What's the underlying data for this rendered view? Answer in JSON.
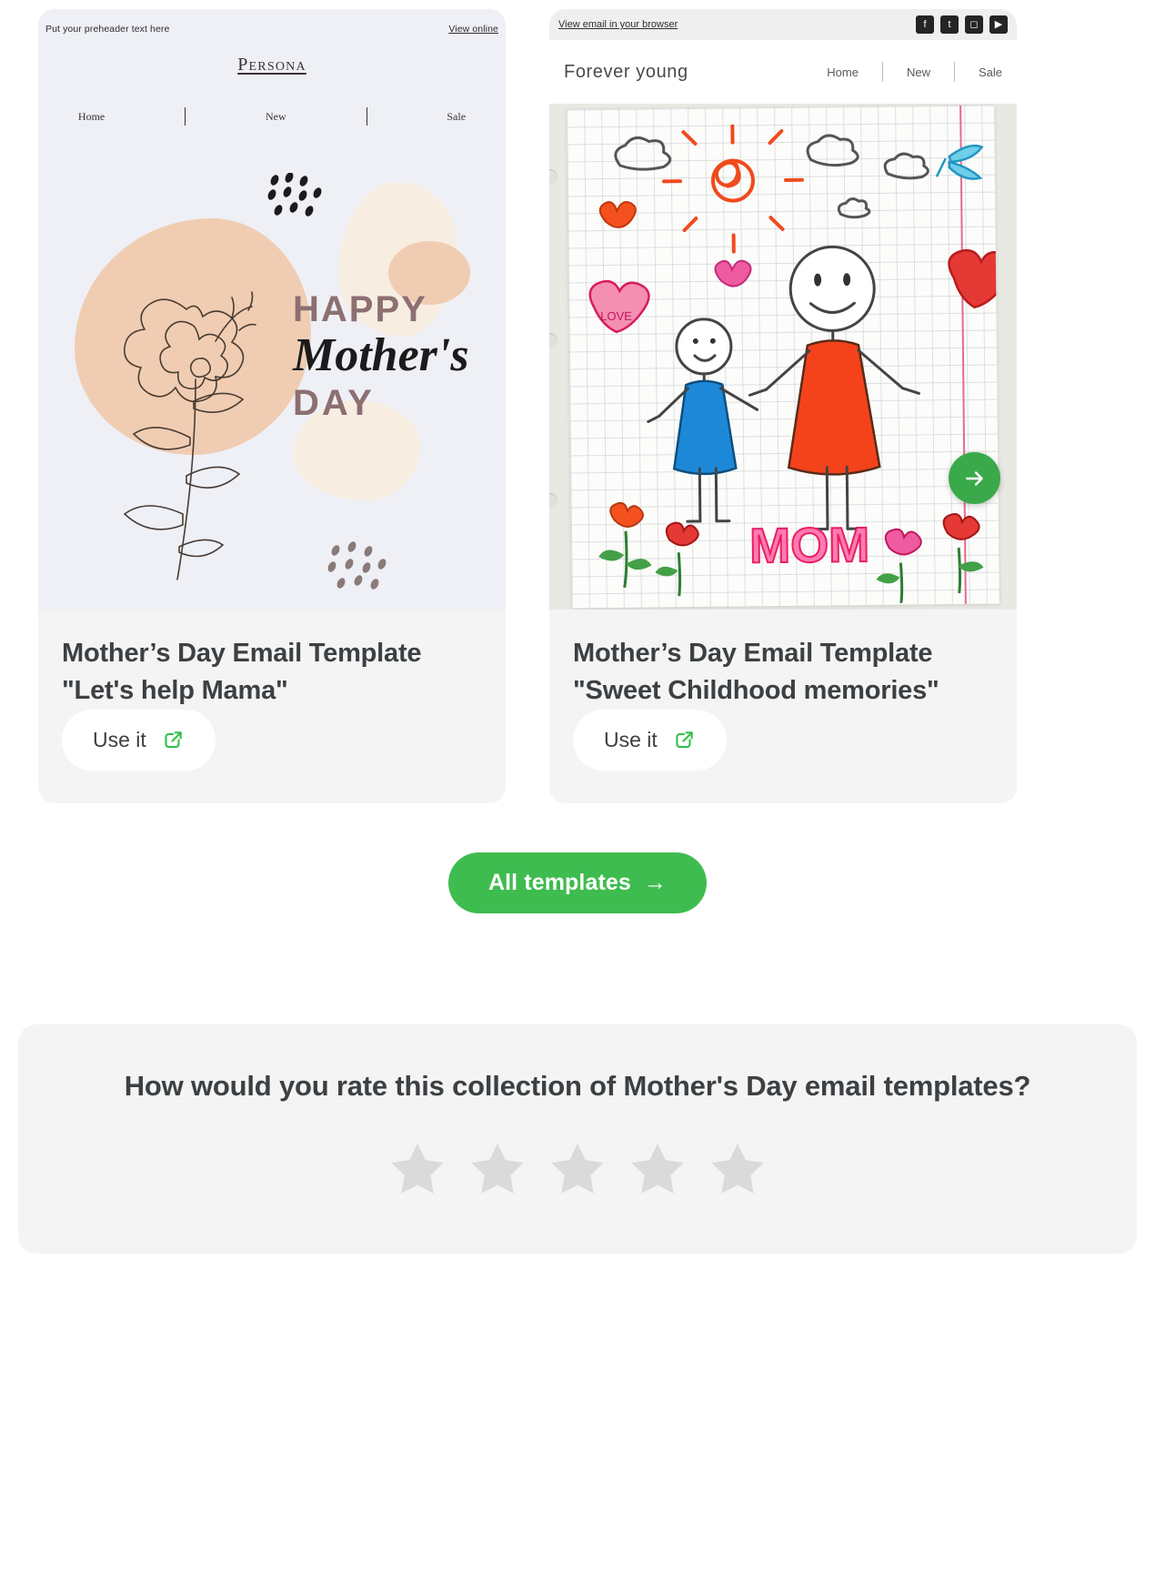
{
  "colors": {
    "accent_green": "#3fbc4f",
    "arrow_button_green": "#3aa94a",
    "card_bg": "#f4f4f4",
    "title_text": "#3c4043",
    "star_gray": "#dadada"
  },
  "templates": [
    {
      "title": "Mother’s Day Email Template \"Let's help Mama\"",
      "use_label": "Use it",
      "use_icon": "external-link-icon",
      "preview": {
        "kind": "persona-email",
        "preheader": "Put your preheader text here",
        "view_online": "View online",
        "brand": "Persona",
        "nav": [
          "Home",
          "New",
          "Sale"
        ],
        "headline_line1": "HAPPY",
        "headline_line2": "Mother's",
        "headline_line3": "DAY"
      }
    },
    {
      "title": "Mother’s Day Email Template \"Sweet Childhood memories\"",
      "use_label": "Use it",
      "use_icon": "external-link-icon",
      "preview": {
        "kind": "forever-young-email",
        "view_in_browser": "View email in your browser",
        "socials": [
          "facebook-icon",
          "twitter-icon",
          "instagram-icon",
          "youtube-icon"
        ],
        "logo": "Forever young",
        "nav": [
          "Home",
          "New",
          "Sale"
        ],
        "drawing_caption": "MOM",
        "heart_label": "LOVE",
        "next_button_icon": "arrow-right-icon"
      }
    }
  ],
  "all_templates": {
    "label": "All templates",
    "arrow": "→"
  },
  "rating": {
    "question": "How would you rate this collection of Mother's Day email templates?",
    "stars_total": 5,
    "stars_selected": 0
  }
}
